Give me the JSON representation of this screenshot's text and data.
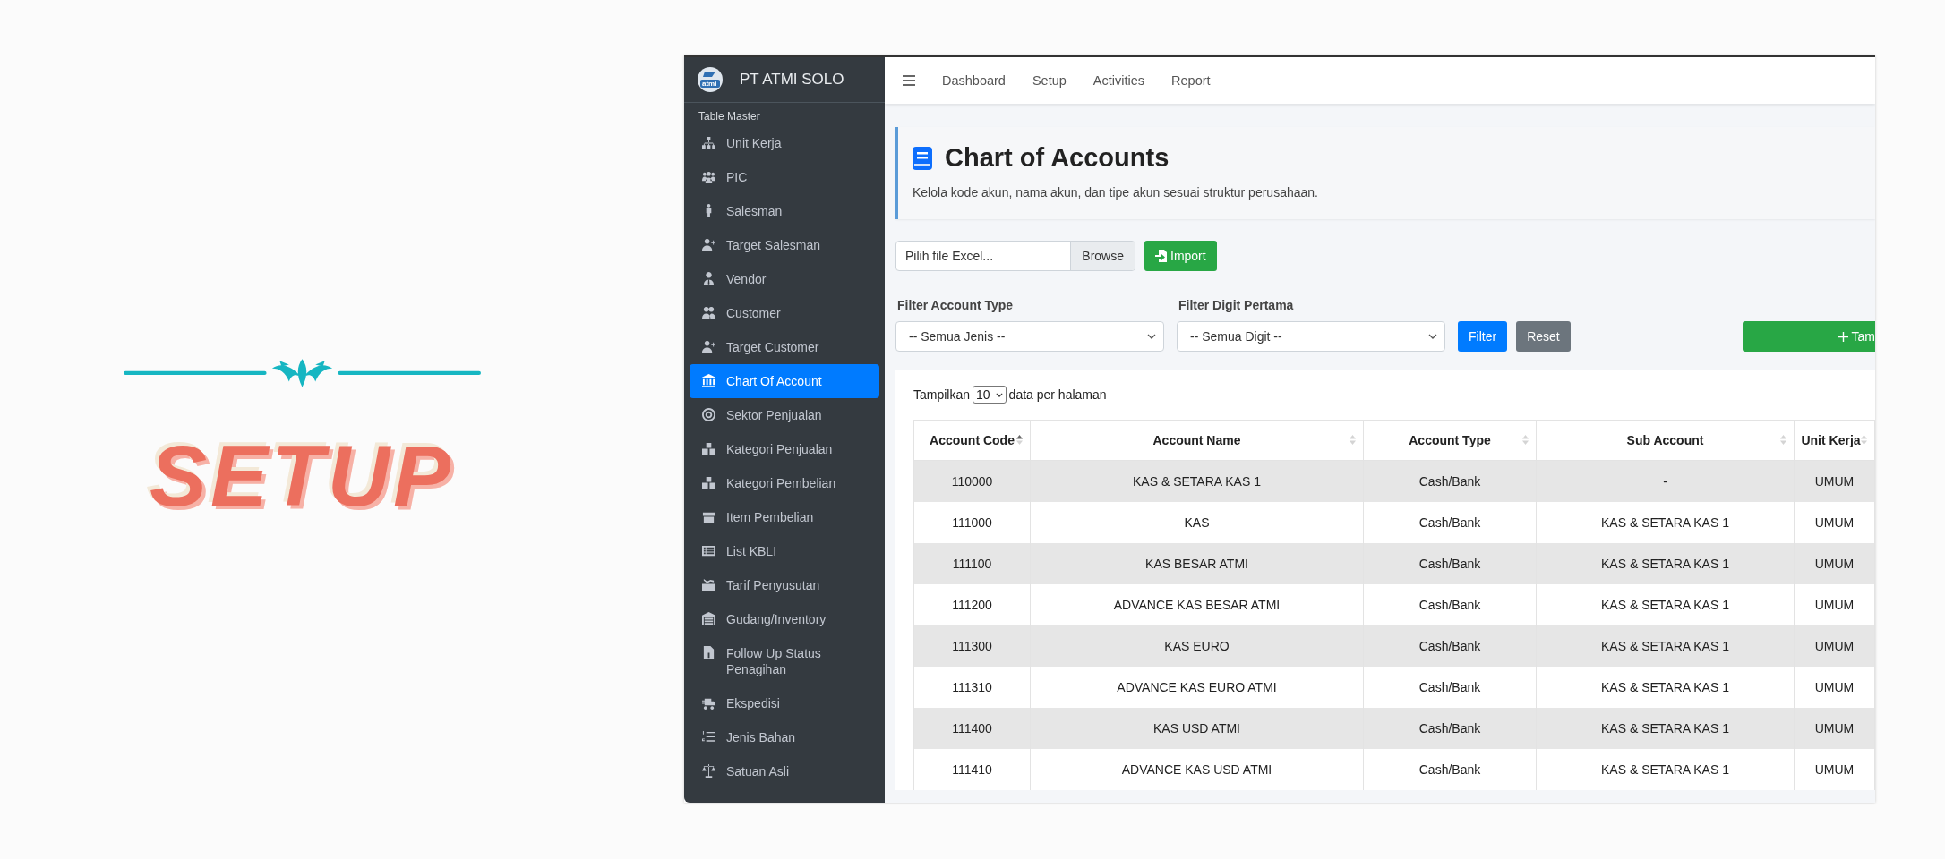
{
  "decoration": {
    "title": "SETUP"
  },
  "app": {
    "brand": {
      "logo_text": "atmi",
      "name": "PT ATMI SOLO"
    },
    "sidebar": {
      "section": "Table Master",
      "items": [
        {
          "label": "Unit Kerja",
          "selected": false
        },
        {
          "label": "PIC",
          "selected": false
        },
        {
          "label": "Salesman",
          "selected": false
        },
        {
          "label": "Target Salesman",
          "selected": false
        },
        {
          "label": "Vendor",
          "selected": false
        },
        {
          "label": "Customer",
          "selected": false
        },
        {
          "label": "Target Customer",
          "selected": false
        },
        {
          "label": "Chart Of Account",
          "selected": true
        },
        {
          "label": "Sektor Penjualan",
          "selected": false
        },
        {
          "label": "Kategori Penjualan",
          "selected": false
        },
        {
          "label": "Kategori Pembelian",
          "selected": false
        },
        {
          "label": "Item Pembelian",
          "selected": false
        },
        {
          "label": "List KBLI",
          "selected": false
        },
        {
          "label": "Tarif Penyusutan",
          "selected": false
        },
        {
          "label": "Gudang/Inventory",
          "selected": false
        },
        {
          "label": "Follow Up Status Penagihan",
          "selected": false
        },
        {
          "label": "Ekspedisi",
          "selected": false
        },
        {
          "label": "Jenis Bahan",
          "selected": false
        },
        {
          "label": "Satuan Asli",
          "selected": false
        }
      ]
    },
    "topnav": [
      "Dashboard",
      "Setup",
      "Activities",
      "Report"
    ],
    "page_header": {
      "title": "Chart of Accounts",
      "subtitle": "Kelola kode akun, nama akun, dan tipe akun sesuai struktur perusahaan."
    },
    "import": {
      "placeholder": "Pilih file Excel...",
      "browse": "Browse",
      "button": "Import"
    },
    "filters": [
      {
        "label": "Filter Account Type",
        "value": "-- Semua Jenis --"
      },
      {
        "label": "Filter Digit Pertama",
        "value": "-- Semua Digit --"
      }
    ],
    "filter_button": "Filter",
    "reset_button": "Reset",
    "add_button": "Tam",
    "page_size": {
      "before": "Tampilkan",
      "value": "10",
      "after": "data per halaman"
    },
    "table": {
      "columns": [
        {
          "label": "Account Code",
          "sorted": true
        },
        {
          "label": "Account Name",
          "sorted": false
        },
        {
          "label": "Account Type",
          "sorted": false
        },
        {
          "label": "Sub Account",
          "sorted": false
        },
        {
          "label": "Unit Kerja",
          "sorted": false
        }
      ],
      "rows": [
        [
          "110000",
          "KAS & SETARA KAS 1",
          "Cash/Bank",
          "-",
          "UMUM"
        ],
        [
          "111000",
          "KAS",
          "Cash/Bank",
          "KAS & SETARA KAS 1",
          "UMUM"
        ],
        [
          "111100",
          "KAS BESAR ATMI",
          "Cash/Bank",
          "KAS & SETARA KAS 1",
          "UMUM"
        ],
        [
          "111200",
          "ADVANCE KAS BESAR ATMI",
          "Cash/Bank",
          "KAS & SETARA KAS 1",
          "UMUM"
        ],
        [
          "111300",
          "KAS EURO",
          "Cash/Bank",
          "KAS & SETARA KAS 1",
          "UMUM"
        ],
        [
          "111310",
          "ADVANCE KAS EURO ATMI",
          "Cash/Bank",
          "KAS & SETARA KAS 1",
          "UMUM"
        ],
        [
          "111400",
          "KAS USD ATMI",
          "Cash/Bank",
          "KAS & SETARA KAS 1",
          "UMUM"
        ],
        [
          "111410",
          "ADVANCE KAS USD ATMI",
          "Cash/Bank",
          "KAS & SETARA KAS 1",
          "UMUM"
        ]
      ]
    }
  }
}
